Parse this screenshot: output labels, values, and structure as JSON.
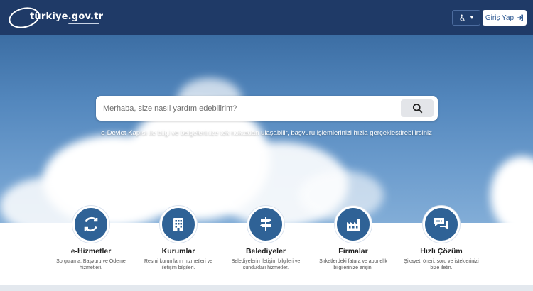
{
  "header": {
    "logo_text": "türkiye.gov.tr",
    "accessibility_icon": "wheelchair-icon",
    "login_label": "Giriş Yap",
    "login_icon": "sign-in-icon"
  },
  "search": {
    "placeholder": "Merhaba, size nasıl yardım edebilirim?",
    "button_icon": "search-icon"
  },
  "tagline": "e-Devlet Kapısı ile bilgi ve belgelerinize tek noktadan ulaşabilir, başvuru işlemlerinizi hızla gerçekleştirebilirsiniz",
  "services": [
    {
      "title": "e-Hizmetler",
      "desc": "Sorgulama, Başvuru ve Ödeme hizmetleri.",
      "icon": "refresh-icon"
    },
    {
      "title": "Kurumlar",
      "desc": "Resmi kurumların hizmetleri ve iletişim bilgileri.",
      "icon": "building-icon"
    },
    {
      "title": "Belediyeler",
      "desc": "Belediyelerin iletişim bilgileri ve sundukları hizmetler.",
      "icon": "signpost-icon"
    },
    {
      "title": "Firmalar",
      "desc": "Şirketlerdeki fatura ve abonelik bilgilerinize erişin.",
      "icon": "factory-icon"
    },
    {
      "title": "Hızlı Çözüm",
      "desc": "Şikayet, öneri, soru ve isteklerinizi bize iletin.",
      "icon": "chat-icon"
    }
  ],
  "colors": {
    "header_bg": "#1f3a67",
    "accent": "#2f6296",
    "login_text": "#2f5a93"
  }
}
